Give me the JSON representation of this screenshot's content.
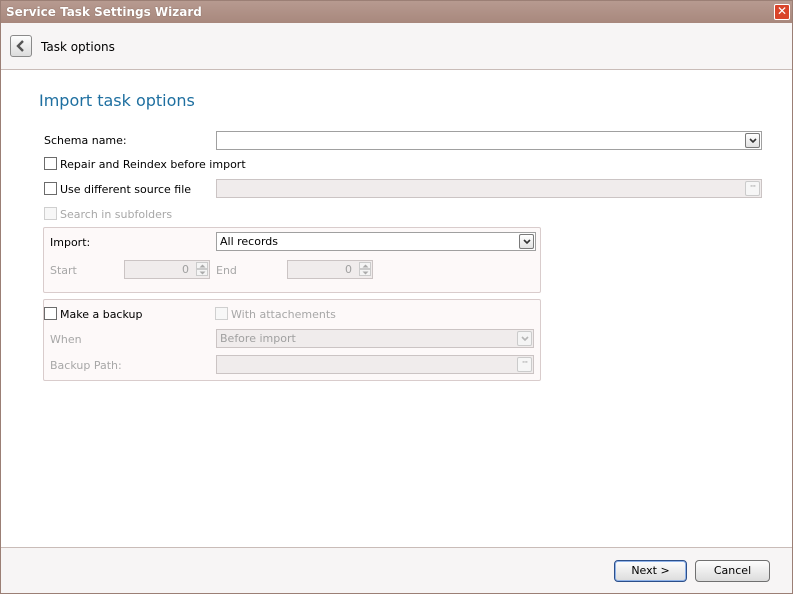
{
  "window": {
    "title": "Service Task Settings Wizard",
    "close": "✕"
  },
  "header": {
    "title": "Task options"
  },
  "section_title": "Import task options",
  "schema": {
    "label": "Schema name:",
    "value": ""
  },
  "repair": {
    "label": "Repair and Reindex before import",
    "checked": false
  },
  "source_file": {
    "label": "Use different source file",
    "value": "",
    "browse": "···"
  },
  "subfolders": {
    "label": "Search in subfolders"
  },
  "import_group": {
    "label": "Import:",
    "selected": "All records",
    "start_label": "Start",
    "start_value": "0",
    "end_label": "End",
    "end_value": "0"
  },
  "backup_group": {
    "make_backup_label": "Make a backup",
    "attachments_label": "With attachements",
    "when_label": "When",
    "when_value": "Before import",
    "path_label": "Backup Path:",
    "path_value": "",
    "browse": "···"
  },
  "footer": {
    "next_label": "Next >",
    "cancel_label": "Cancel"
  },
  "icons": [
    "back-arrow-icon",
    "close-icon",
    "chevron-down-icon",
    "ellipsis-icon",
    "spin-up-icon",
    "spin-down-icon"
  ]
}
